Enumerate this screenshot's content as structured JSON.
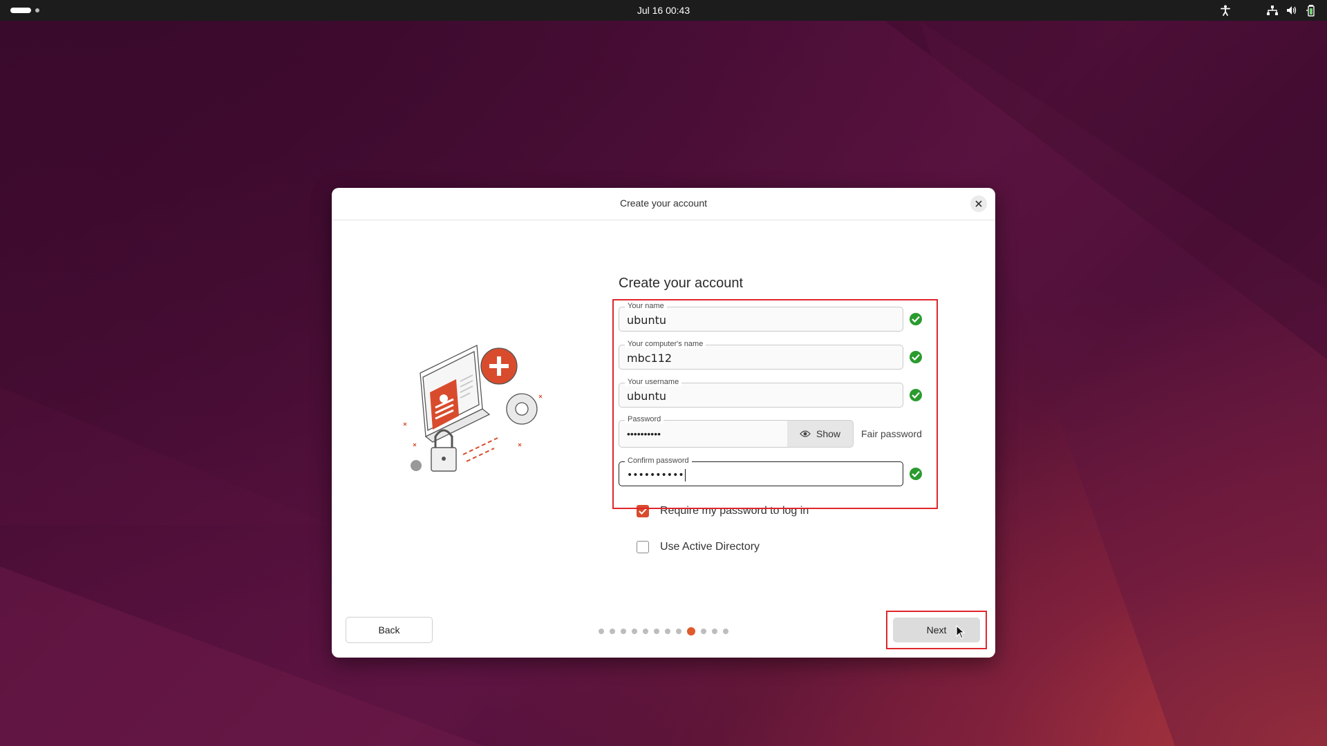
{
  "topbar": {
    "datetime": "Jul 16  00:43",
    "icons": [
      "accessibility-icon",
      "network-icon",
      "volume-icon",
      "battery-icon"
    ]
  },
  "dialog": {
    "title": "Create your account",
    "heading": "Create your account",
    "fields": {
      "your_name": {
        "label": "Your name",
        "value": "ubuntu",
        "valid": true
      },
      "computer_name": {
        "label": "Your computer's name",
        "value": "mbc112",
        "valid": true
      },
      "username": {
        "label": "Your username",
        "value": "ubuntu",
        "valid": true
      },
      "password": {
        "label": "Password",
        "value": "••••••••••",
        "show_label": "Show",
        "strength": "Fair password"
      },
      "confirm_password": {
        "label": "Confirm password",
        "value": "••••••••••",
        "valid": true
      }
    },
    "options": {
      "require_password": {
        "label": "Require my password to log in",
        "checked": true
      },
      "active_directory": {
        "label": "Use Active Directory",
        "checked": false
      }
    },
    "buttons": {
      "back": "Back",
      "next": "Next"
    },
    "progress": {
      "total_steps": 12,
      "current_step": 9
    }
  },
  "colors": {
    "accent": "#e05a2c",
    "checkbox": "#d84c2d",
    "valid": "#2a9b2f",
    "highlight": "#e0252b"
  }
}
